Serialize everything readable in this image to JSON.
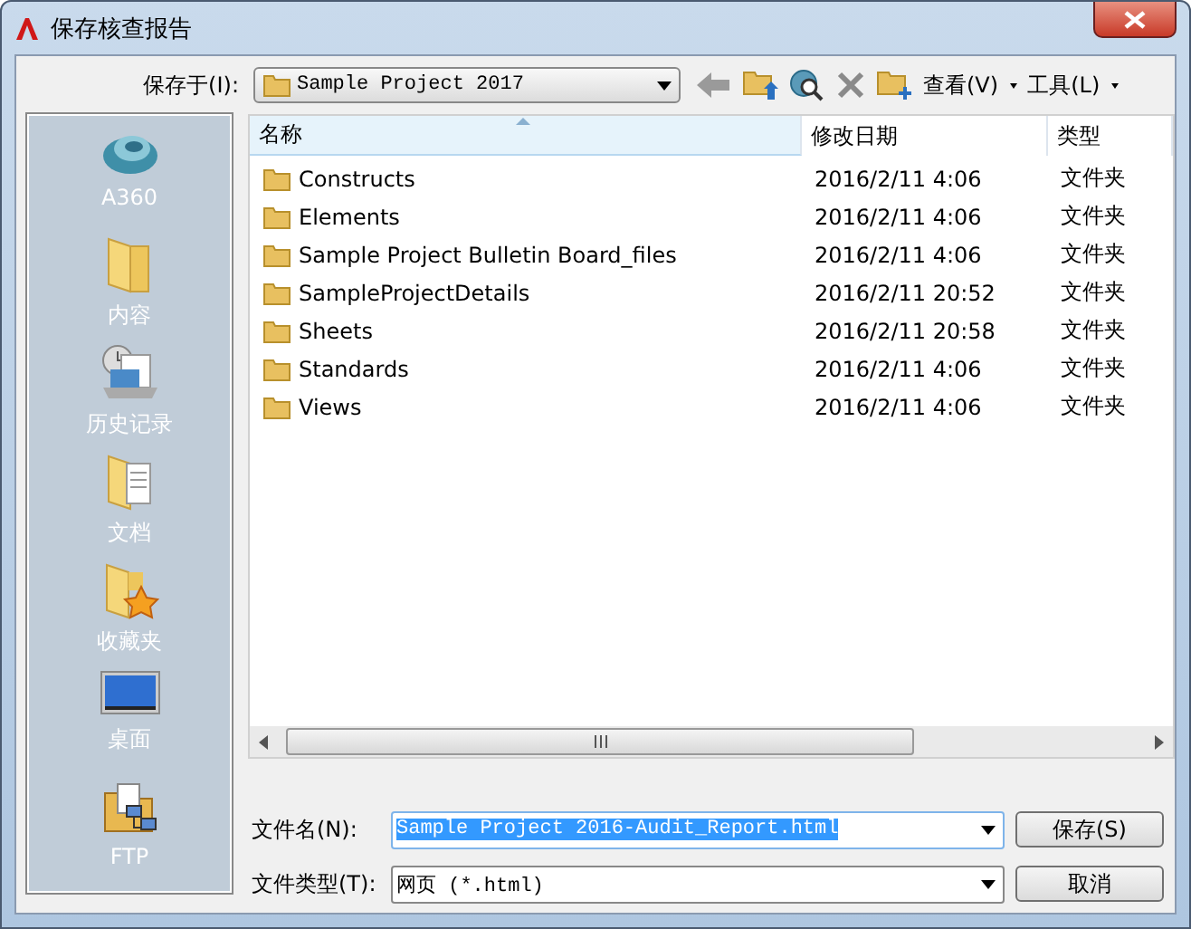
{
  "window": {
    "title": "保存核查报告"
  },
  "save_in": {
    "label": "保存于(I):",
    "value": "Sample Project 2017"
  },
  "view_menu": "查看(V)",
  "tools_menu": "工具(L)",
  "sidebar": [
    {
      "kind": "cloud",
      "label": "A360"
    },
    {
      "kind": "folder",
      "label": "内容"
    },
    {
      "kind": "history",
      "label": "历史记录"
    },
    {
      "kind": "documents",
      "label": "文档"
    },
    {
      "kind": "favorites",
      "label": "收藏夹"
    },
    {
      "kind": "desktop",
      "label": "桌面"
    },
    {
      "kind": "ftp",
      "label": "FTP"
    }
  ],
  "columns": [
    {
      "label": "名称",
      "sorted": true
    },
    {
      "label": "修改日期",
      "sorted": false
    },
    {
      "label": "类型",
      "sorted": false
    }
  ],
  "rows": [
    {
      "name": "Constructs",
      "date": "2016/2/11 4:06",
      "type": "文件夹"
    },
    {
      "name": "Elements",
      "date": "2016/2/11 4:06",
      "type": "文件夹"
    },
    {
      "name": "Sample Project Bulletin Board_files",
      "date": "2016/2/11 4:06",
      "type": "文件夹"
    },
    {
      "name": "SampleProjectDetails",
      "date": "2016/2/11 20:52",
      "type": "文件夹"
    },
    {
      "name": "Sheets",
      "date": "2016/2/11 20:58",
      "type": "文件夹"
    },
    {
      "name": "Standards",
      "date": "2016/2/11 4:06",
      "type": "文件夹"
    },
    {
      "name": "Views",
      "date": "2016/2/11 4:06",
      "type": "文件夹"
    }
  ],
  "file_name": {
    "label": "文件名(N):",
    "value": "Sample Project 2016-Audit_Report.html",
    "selected": true
  },
  "file_type": {
    "label": "文件类型(T):",
    "value": "网页 (*.html)"
  },
  "buttons": [
    "保存(S)",
    "取消"
  ]
}
